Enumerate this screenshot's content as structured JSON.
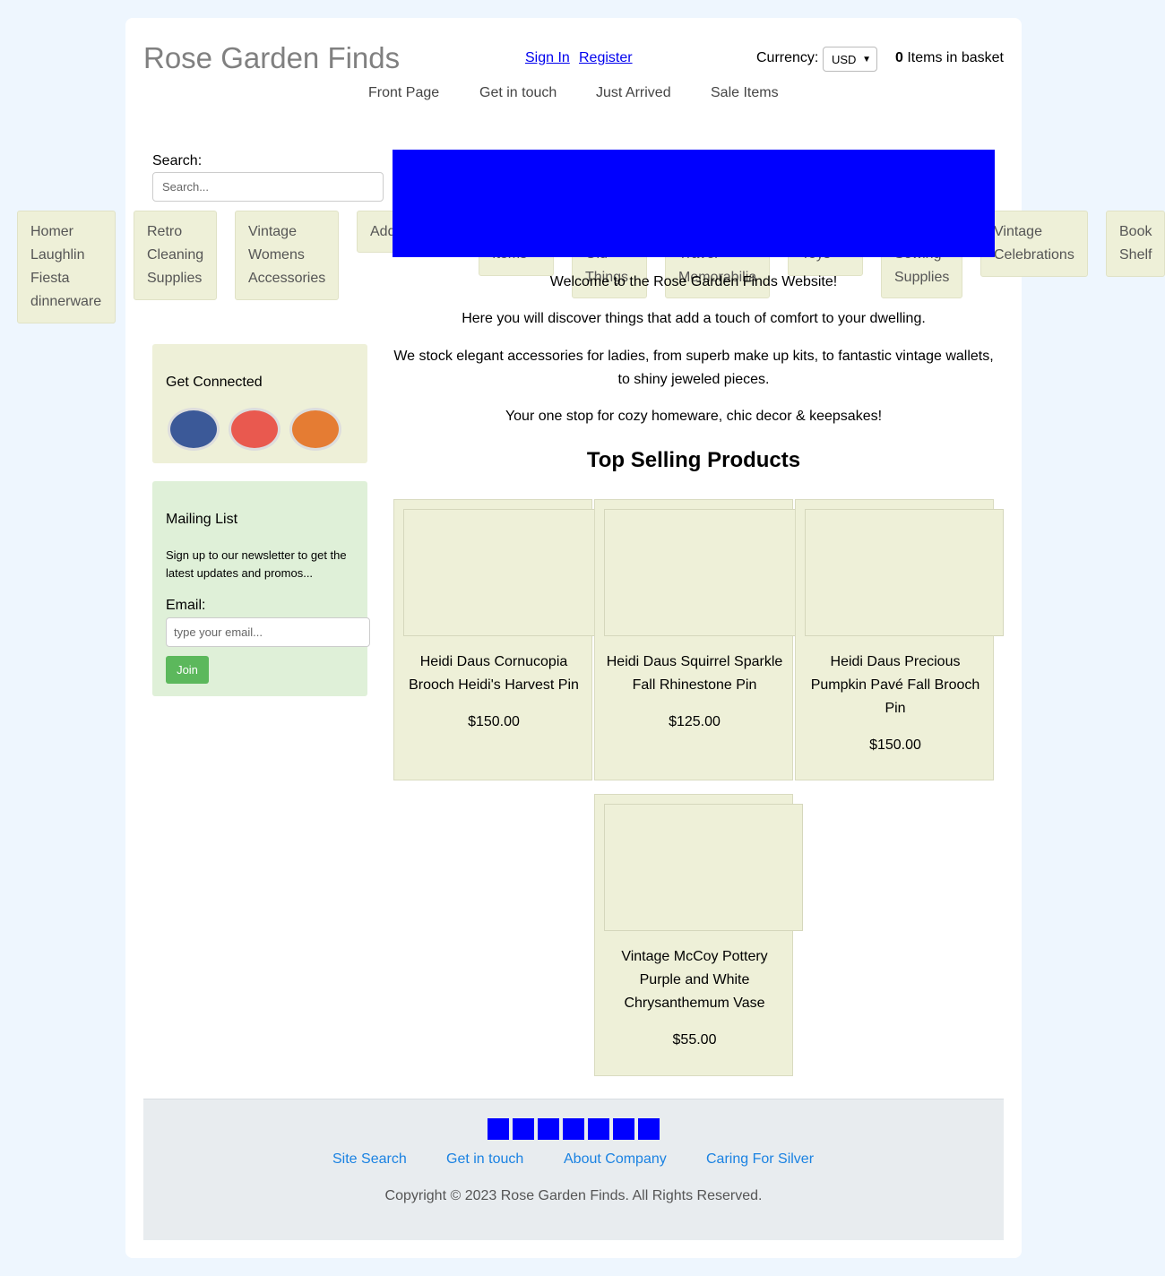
{
  "header": {
    "site_title": "Rose Garden Finds",
    "sign_in": "Sign In",
    "register": "Register",
    "currency_label": "Currency:",
    "currency_value": "USD",
    "basket_count": "0",
    "basket_label": "Items in basket"
  },
  "topnav": [
    "Front Page",
    "Get in touch",
    "Just Arrived",
    "Sale Items"
  ],
  "search": {
    "label": "Search:",
    "placeholder": "Search..."
  },
  "categories": [
    "Homer Laughlin Fiesta dinnerware",
    "Retro Cleaning Supplies",
    "Vintage Womens Accessories",
    "Add",
    "Items",
    "Old Things",
    "Travel Memorabilia",
    "Toys",
    "Sewing Supplies",
    "Vintage Celebrations",
    "Book Shelf"
  ],
  "welcome": [
    "Welcome to the Rose Garden Finds Website!",
    "Here you will discover things that add a touch of comfort to your dwelling.",
    "We stock elegant accessories for ladies, from superb make up kits, to fantastic vintage wallets, to shiny jeweled pieces.",
    "Your one stop for cozy homeware, chic decor & keepsakes!"
  ],
  "top_selling_title": "Top Selling Products",
  "products": [
    {
      "name": "Heidi Daus Cornucopia Brooch Heidi's Harvest Pin",
      "price": "$150.00"
    },
    {
      "name": "Heidi Daus Squirrel Sparkle Fall Rhinestone Pin",
      "price": "$125.00"
    },
    {
      "name": "Heidi Daus Precious Pumpkin Pavé Fall Brooch Pin",
      "price": "$150.00"
    },
    {
      "name": "Vintage McCoy Pottery Purple and White Chrysanthemum Vase",
      "price": "$55.00"
    }
  ],
  "get_connected": {
    "title": "Get Connected",
    "icons": [
      "facebook-icon",
      "pinterest-icon",
      "instagram-icon"
    ],
    "colors": [
      "#3b5998",
      "#e9594f",
      "#e57c33"
    ]
  },
  "mailing": {
    "title": "Mailing List",
    "description": "Sign up to our newsletter to get the latest updates and promos...",
    "email_label": "Email:",
    "email_placeholder": "type your email...",
    "join": "Join"
  },
  "footer": {
    "links": [
      "Site Search",
      "Get in touch",
      "About Company",
      "Caring For Silver"
    ],
    "copyright": "Copyright © 2023 Rose Garden Finds. All Rights Reserved."
  },
  "colors": {
    "background": "#eef6fe",
    "category_bg": "#eef0d8",
    "banner": "#0000ff",
    "join_button": "#5cb85c",
    "footer_link": "#1a82e2"
  }
}
